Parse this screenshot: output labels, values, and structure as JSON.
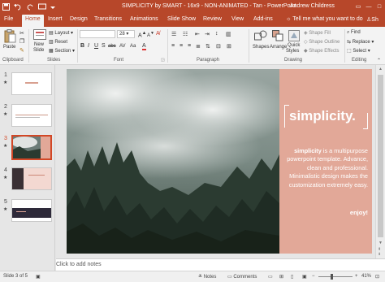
{
  "window": {
    "title": "SIMPLICITY by SMART - 16x9 - NON-ANIMATED - Tan - PowerPoint",
    "user": "Andrew Childress"
  },
  "tabs": [
    "File",
    "Home",
    "Insert",
    "Design",
    "Transitions",
    "Animations",
    "Slide Show",
    "Review",
    "View",
    "Add-ins"
  ],
  "tell_me": "Tell me what you want to do",
  "share": "Sh",
  "ribbon": {
    "groups": {
      "clipboard": "Clipboard",
      "slides": "Slides",
      "font": "Font",
      "paragraph": "Paragraph",
      "drawing": "Drawing",
      "editing": "Editing"
    },
    "paste": "Paste",
    "new_slide_1": "New",
    "new_slide_2": "Slide",
    "layout": "Layout",
    "reset": "Reset",
    "section": "Section",
    "font_size": "28",
    "shapes": "Shapes",
    "arrange": "Arrange",
    "quick_styles_1": "Quick",
    "quick_styles_2": "Styles",
    "shape_fill": "Shape Fill",
    "shape_outline": "Shape Outline",
    "shape_effects": "Shape Effects",
    "find": "Find",
    "replace": "Replace",
    "select": "Select",
    "font_buttons": [
      "B",
      "I",
      "U",
      "S",
      "abc",
      "AV",
      "Aa",
      "A"
    ]
  },
  "thumbnails": [
    {
      "number": "1",
      "star": "★"
    },
    {
      "number": "2",
      "star": "★"
    },
    {
      "number": "3",
      "star": "★"
    },
    {
      "number": "4",
      "star": "★"
    },
    {
      "number": "5",
      "star": "★"
    }
  ],
  "slide": {
    "heading": "simplicity.",
    "body_bold": "simplicity",
    "body": "is a multipurpose powerpoint template. Advance, clean and professional. Minimalistic design makes the customization extremely easy.",
    "cta": "enjoy!"
  },
  "notes_placeholder": "Click to add notes",
  "status": {
    "slide_info": "Slide 3 of 5",
    "notes": "Notes",
    "comments": "Comments",
    "zoom": "41%"
  },
  "colors": {
    "accent": "#b7472a",
    "panel": "#e2a898",
    "selected": "#d24726"
  }
}
